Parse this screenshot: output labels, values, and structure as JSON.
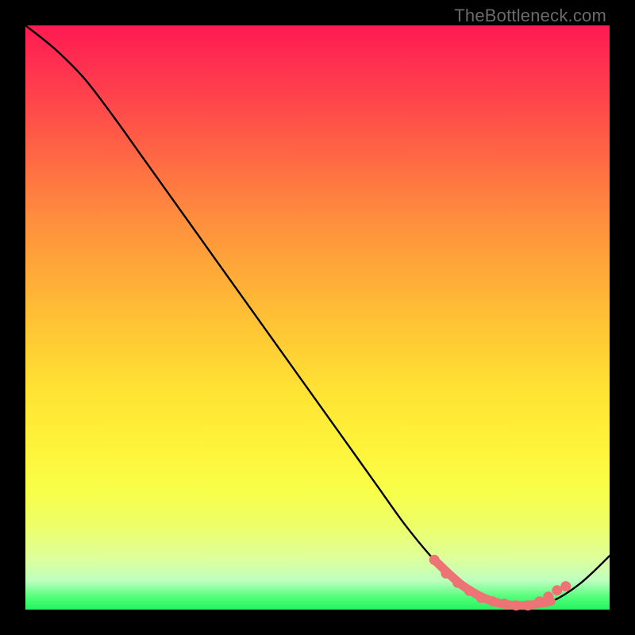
{
  "watermark": "TheBottleneck.com",
  "chart_data": {
    "type": "line",
    "title": "",
    "xlabel": "",
    "ylabel": "",
    "xlim": [
      0,
      100
    ],
    "ylim": [
      0,
      100
    ],
    "grid": false,
    "legend": false,
    "background_gradient": {
      "top": "#ff1a52",
      "mid": "#ffe233",
      "bottom": "#24f362"
    },
    "series": [
      {
        "name": "curve",
        "color": "#000000",
        "x": [
          0,
          5,
          10,
          15,
          20,
          25,
          30,
          35,
          40,
          45,
          50,
          55,
          60,
          65,
          70,
          75,
          80,
          85,
          90,
          95,
          100
        ],
        "y": [
          100,
          96,
          91,
          84.5,
          77.5,
          70.5,
          63.5,
          56.5,
          49.5,
          42.5,
          35.5,
          28.5,
          21.5,
          14.5,
          8.5,
          4.0,
          1.4,
          0.7,
          1.4,
          4.5,
          9.2
        ]
      },
      {
        "name": "markers",
        "color": "#ed7374",
        "marker": "circle",
        "x": [
          70,
          72,
          74,
          76,
          78,
          80,
          82,
          84,
          86,
          88,
          89.5,
          91,
          92.5
        ],
        "y": [
          8.5,
          6.2,
          4.6,
          3.2,
          2.0,
          1.4,
          1.0,
          0.7,
          0.7,
          1.4,
          2.2,
          3.3,
          4.0
        ]
      }
    ]
  }
}
